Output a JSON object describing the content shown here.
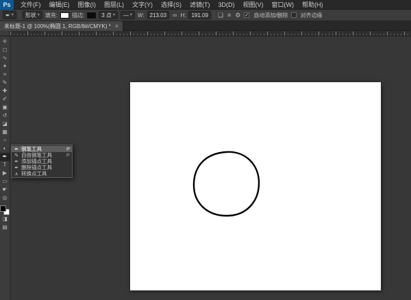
{
  "app": {
    "logo": "Ps",
    "menu_items": [
      "文件(F)",
      "编辑(E)",
      "图像(I)",
      "图层(L)",
      "文字(Y)",
      "选择(S)",
      "滤镜(T)",
      "3D(D)",
      "视图(V)",
      "窗口(W)",
      "帮助(H)"
    ]
  },
  "options_bar": {
    "tool_preset_icon": "✒",
    "mode_value": "形状",
    "fill_label": "填充:",
    "stroke_label": "描边:",
    "stroke_width_value": "3 点",
    "stroke_style_glyph": "—",
    "w_label": "W:",
    "w_value": "213.03",
    "link_glyph": "∞",
    "h_label": "H:",
    "h_value": "191.09",
    "path_ops_glyph": "❏",
    "path_align_glyph": "≡",
    "gear_glyph": "⚙",
    "check_glyph": "✓",
    "auto_add_delete_label": "自动添加/删除",
    "align_edges_label": "对齐边缘"
  },
  "tab": {
    "title": "未标题-1 @ 100%(椭圆 1, RGB/8#/CMYK) *",
    "close_glyph": "×"
  },
  "toolbar": {
    "tools": [
      {
        "name": "move-tool",
        "glyph": "✛"
      },
      {
        "name": "rectangular-marquee-tool",
        "glyph": "◻"
      },
      {
        "name": "lasso-tool",
        "glyph": "∿"
      },
      {
        "name": "quick-selection-tool",
        "glyph": "✦"
      },
      {
        "name": "crop-tool",
        "glyph": "⌗"
      },
      {
        "name": "eyedropper-tool",
        "glyph": "✎"
      },
      {
        "name": "spot-healing-brush-tool",
        "glyph": "✚"
      },
      {
        "name": "brush-tool",
        "glyph": "✐"
      },
      {
        "name": "clone-stamp-tool",
        "glyph": "▣"
      },
      {
        "name": "history-brush-tool",
        "glyph": "↺"
      },
      {
        "name": "eraser-tool",
        "glyph": "◪"
      },
      {
        "name": "gradient-tool",
        "glyph": "▦"
      },
      {
        "name": "blur-tool",
        "glyph": "○"
      },
      {
        "name": "dodge-tool",
        "glyph": "◐"
      },
      {
        "name": "pen-tool",
        "glyph": "✒"
      },
      {
        "name": "type-tool",
        "glyph": "T"
      },
      {
        "name": "path-selection-tool",
        "glyph": "▶"
      },
      {
        "name": "rectangle-tool",
        "glyph": "▭"
      },
      {
        "name": "hand-tool",
        "glyph": "☛"
      },
      {
        "name": "zoom-tool",
        "glyph": "◎"
      }
    ],
    "extra_tools": [
      {
        "name": "quick-mask-button",
        "glyph": "◨"
      },
      {
        "name": "screen-mode-button",
        "glyph": "▤"
      }
    ]
  },
  "flyout": {
    "items": [
      {
        "label": "钢笔工具",
        "glyph": "✒",
        "shortcut": "P",
        "selected": true
      },
      {
        "label": "自由钢笔工具",
        "glyph": "✎",
        "shortcut": "P",
        "selected": false
      },
      {
        "label": "添加锚点工具",
        "glyph": "✒",
        "shortcut": "",
        "selected": false
      },
      {
        "label": "删除锚点工具",
        "glyph": "✒",
        "shortcut": "",
        "selected": false
      },
      {
        "label": "转换点工具",
        "glyph": "∧",
        "shortcut": "",
        "selected": false
      }
    ]
  },
  "colors": {
    "logo_bg": "#10578f",
    "fill_swatch": "#ffffff",
    "stroke_swatch": "#0a0a0a",
    "shape_stroke": "#000000"
  }
}
